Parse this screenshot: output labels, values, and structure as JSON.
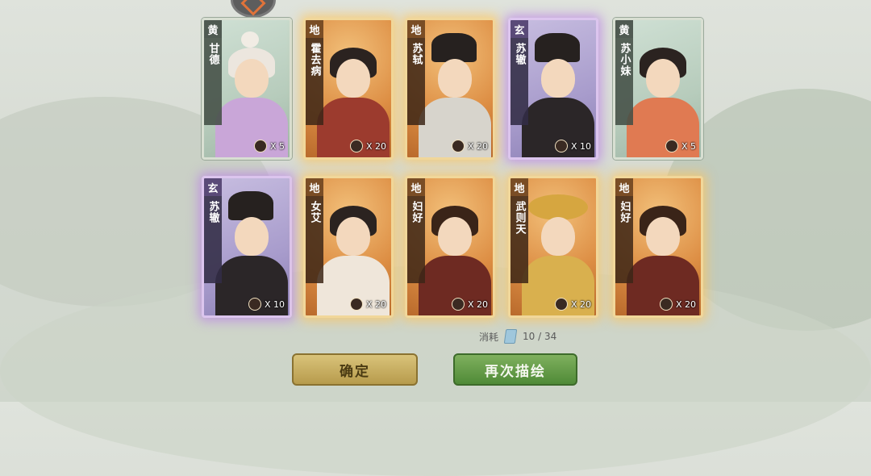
{
  "cards": [
    {
      "rarity": "黄",
      "name": "甘德",
      "count": "X 5"
    },
    {
      "rarity": "地",
      "name": "霍去病",
      "count": "X 20"
    },
    {
      "rarity": "地",
      "name": "苏轼",
      "count": "X 20"
    },
    {
      "rarity": "玄",
      "name": "苏辙",
      "count": "X 10"
    },
    {
      "rarity": "黄",
      "name": "苏小妹",
      "count": "X 5"
    },
    {
      "rarity": "玄",
      "name": "苏辙",
      "count": "X 10"
    },
    {
      "rarity": "地",
      "name": "女艾",
      "count": "X 20"
    },
    {
      "rarity": "地",
      "name": "妇好",
      "count": "X 20"
    },
    {
      "rarity": "地",
      "name": "武则天",
      "count": "X 20"
    },
    {
      "rarity": "地",
      "name": "妇好",
      "count": "X 20"
    }
  ],
  "cost": {
    "label": "消耗",
    "value": "10 / 34",
    "icon": "ticket-icon"
  },
  "buttons": {
    "confirm": "确定",
    "draw_again": "再次描绘"
  },
  "colors": {
    "huang": "#b7ccbc",
    "di": "#dd8e44",
    "xuan": "#a89ccc",
    "confirm": "#c9b062",
    "draw_again": "#5f9a45"
  }
}
